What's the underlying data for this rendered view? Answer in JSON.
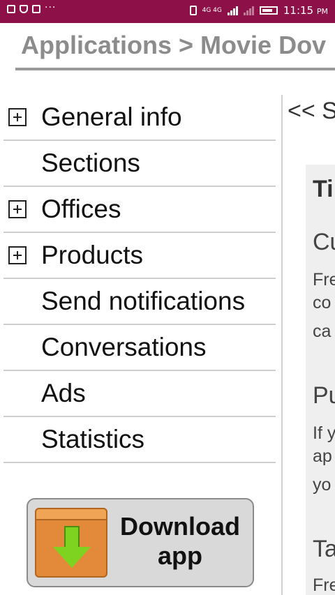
{
  "status_bar": {
    "color": "#8e1048",
    "left_icons": [
      "image-icon",
      "download-icon",
      "mail-icon"
    ],
    "overflow_dots": "···",
    "network_label": "4G 4G",
    "time": "11:15",
    "ampm": "PM"
  },
  "header": {
    "breadcrumb": "Applications > Movie Dov"
  },
  "menu": {
    "items": [
      {
        "label": "General info",
        "expandable": true
      },
      {
        "label": "Sections",
        "expandable": false
      },
      {
        "label": "Offices",
        "expandable": true
      },
      {
        "label": "Products",
        "expandable": true
      },
      {
        "label": "Send notifications",
        "expandable": false
      },
      {
        "label": "Conversations",
        "expandable": false
      },
      {
        "label": "Ads",
        "expandable": false
      },
      {
        "label": "Statistics",
        "expandable": false
      }
    ]
  },
  "download": {
    "line1": "Download",
    "line2": "app"
  },
  "right_pane": {
    "back_link": "<< S",
    "card_title": "Ti",
    "section1_heading": "Cu",
    "section1_lines": [
      "Fre",
      "co",
      "ca"
    ],
    "section2_heading": "Pu",
    "section2_lines": [
      "If y",
      "ap",
      "yo"
    ],
    "section3_heading": "Ta",
    "section3_lines": [
      "Fre"
    ]
  }
}
